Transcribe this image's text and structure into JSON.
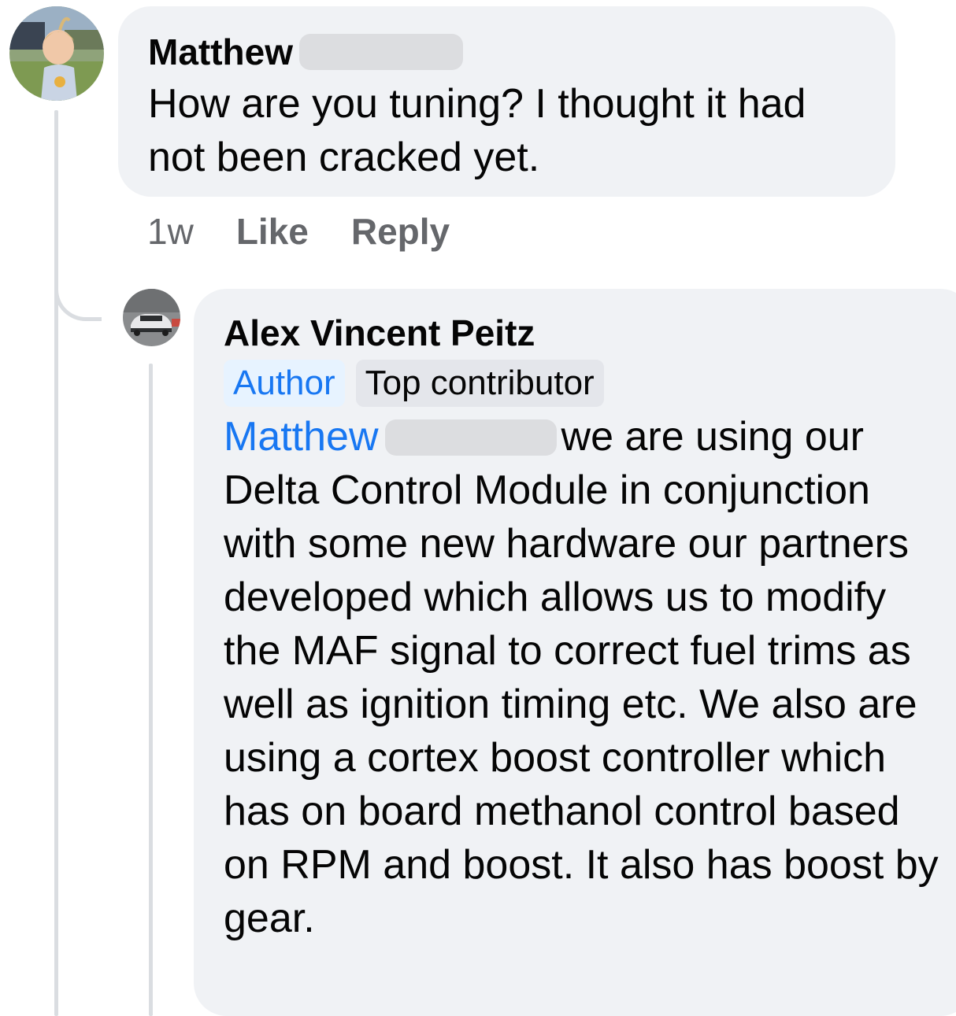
{
  "comments": [
    {
      "author": "Matthew",
      "text": "How are you tuning? I thought it had not been cracked yet.",
      "time": "1w",
      "actions": {
        "like": "Like",
        "reply": "Reply"
      }
    },
    {
      "author": "Alex Vincent Peitz",
      "badges": {
        "author": "Author",
        "top": "Top contributor"
      },
      "mention": "Matthew",
      "text": "we are using our Delta Control Module in conjunction with some new hardware our partners developed which allows us to modify the MAF signal to correct fuel trims as well as ignition timing etc. We also are using a cortex boost controller which has on board methanol control based on RPM and boost. It also has boost by gear."
    }
  ],
  "colors": {
    "bubble": "#f0f2f5",
    "link": "#1877f2",
    "muted": "#65676b",
    "thread_line": "#dadde1"
  }
}
